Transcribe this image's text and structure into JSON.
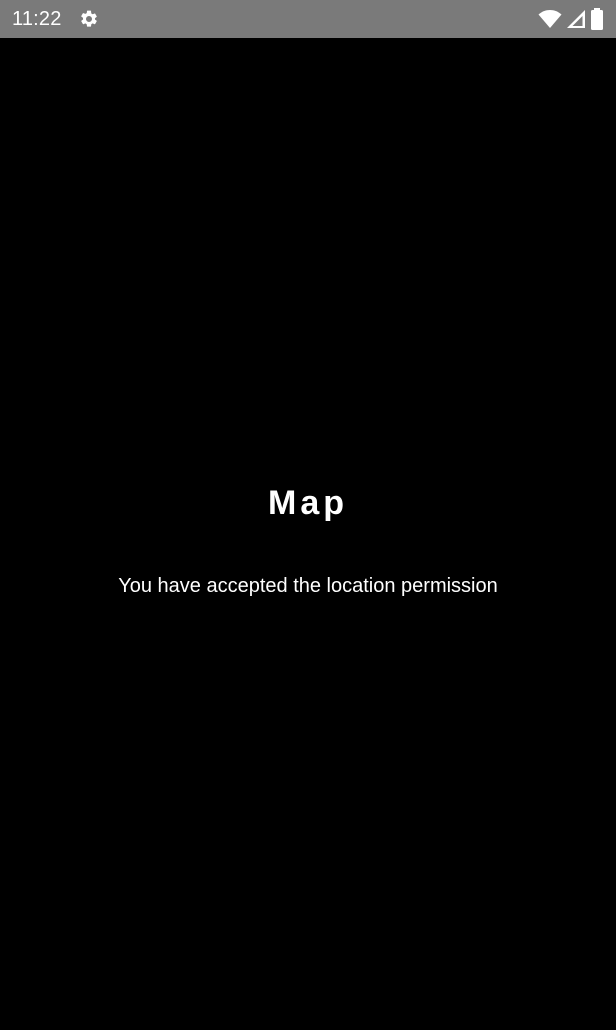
{
  "status_bar": {
    "time": "11:22",
    "icons": [
      "gear-icon",
      "wifi-icon",
      "signal-icon",
      "battery-icon"
    ],
    "background": "#7a7a7a"
  },
  "main": {
    "title": "Map",
    "message": "You have accepted the location permission"
  },
  "colors": {
    "background": "#000000",
    "text": "#ffffff"
  }
}
